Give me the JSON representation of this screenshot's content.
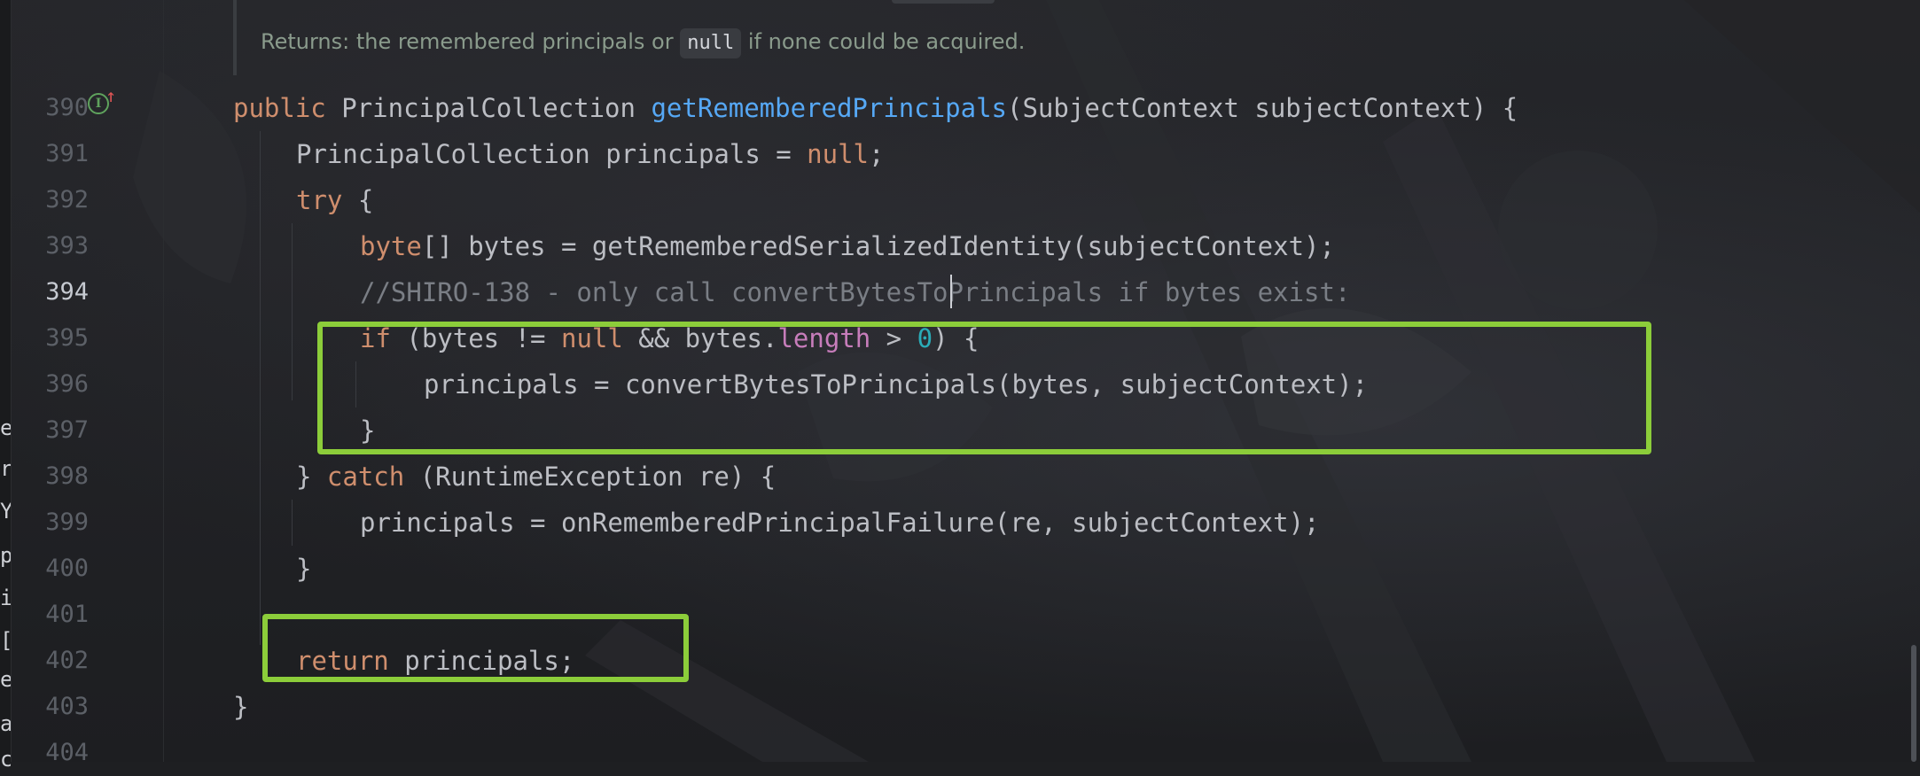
{
  "doc": {
    "prefix": "Returns: the remembered principals or",
    "code": "null",
    "suffix": "if none could be acquired."
  },
  "left_strip_chars": [
    "e",
    "r",
    "Y",
    "p",
    "ic",
    "[",
    "e[",
    "a",
    "c"
  ],
  "line_numbers": [
    "390",
    "391",
    "392",
    "393",
    "394",
    "395",
    "396",
    "397",
    "398",
    "399",
    "400",
    "401",
    "402",
    "403",
    "404"
  ],
  "current_line": "394",
  "code": {
    "l390": {
      "kw": "public",
      "type": "PrincipalCollection",
      "method": "getRememberedPrincipals",
      "params": "(SubjectContext subjectContext) {"
    },
    "l391": {
      "pre": "PrincipalCollection principals = ",
      "null": "null",
      "post": ";"
    },
    "l392": {
      "kw": "try",
      "post": " {"
    },
    "l393": {
      "kw": "byte",
      "post": "[] bytes = getRememberedSerializedIdentity(subjectContext);"
    },
    "l394": {
      "comment": "//SHIRO-138 - only call convertBytesToPrincipals if bytes exist:"
    },
    "l395": {
      "kw_if": "if",
      "a": " (bytes != ",
      "null": "null",
      "b": " && bytes.",
      "field": "length",
      "c": " > ",
      "num": "0",
      "d": ") {"
    },
    "l396": {
      "text": "principals = convertBytesToPrincipals(bytes, subjectContext);"
    },
    "l397": {
      "text": "}"
    },
    "l398": {
      "pre": "} ",
      "kw": "catch",
      "post": " (RuntimeException re) {"
    },
    "l399": {
      "text": "principals = onRememberedPrincipalFailure(re, subjectContext);"
    },
    "l400": {
      "text": "}"
    },
    "l402": {
      "kw": "return",
      "post": " principals;"
    },
    "l403": {
      "text": "}"
    }
  },
  "colors": {
    "background": "#1e1f22",
    "keyword": "#cf8e6d",
    "method": "#56a8f5",
    "field": "#c77dbb",
    "number": "#2aacb8",
    "comment": "#7a7e85",
    "highlight_box": "#8ccd3a"
  },
  "icons": {
    "implements": "implements-interface-icon",
    "arrow": "up-arrow-icon"
  }
}
